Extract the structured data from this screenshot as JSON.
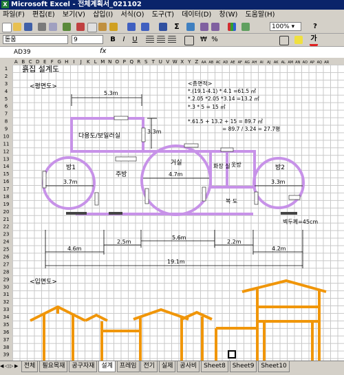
{
  "window": {
    "title": "Microsoft Excel - 전체계획서_021102"
  },
  "menu": [
    "파일(F)",
    "편집(E)",
    "보기(V)",
    "삽입(I)",
    "서식(O)",
    "도구(T)",
    "데이터(D)",
    "창(W)",
    "도움말(H)"
  ],
  "toolbar": {
    "zoom": "100%",
    "font": "돋움",
    "size": "9"
  },
  "formula": {
    "namebox": "AD39",
    "fx": "fx"
  },
  "columns": [
    "A",
    "B",
    "C",
    "D",
    "E",
    "F",
    "G",
    "H",
    "I",
    "J",
    "K",
    "L",
    "M",
    "N",
    "O",
    "P",
    "Q",
    "R",
    "S",
    "T",
    "U",
    "V",
    "W",
    "X",
    "Y",
    "Z",
    "AA",
    "AB",
    "AC",
    "AD",
    "AE",
    "AF",
    "AG",
    "AH",
    "AI",
    "AJ",
    "AK",
    "AL",
    "AM",
    "AN",
    "AO",
    "AP",
    "AQ",
    "AR"
  ],
  "rows": 39,
  "sheet": {
    "title": "흙집 설계도",
    "plan_label": "<평면도>",
    "elev_label": "<입면도>",
    "area_title": "<총면적>",
    "area_lines": [
      "*.(19.1-4.1) * 4.1 =61.5 ㎡",
      "*.2.05 *2.05 *3.14 =13.2 ㎡",
      "*.3 * 5 = 15 ㎡"
    ],
    "area_total1": "*.61.5 + 13.2 + 15 = 89.7 ㎡",
    "area_total2": "= 89.7 / 3.24 = 27.7평",
    "rooms": {
      "room1": "방1",
      "room1_w": "3.7m",
      "kitchen": "주방",
      "living": "거실",
      "living_w": "4.7m",
      "bath": "화장\n실",
      "closet": "옷방",
      "hall": "복 도",
      "room2": "방2",
      "room2_w": "3.3m",
      "utility": "다용도/보일러실"
    },
    "dims": {
      "top": "5.3m",
      "util_h": "3.3m",
      "wall": "벽두께=45cm",
      "d1": "4.6m",
      "d2": "2.5m",
      "d3": "5.6m",
      "d4": "2.2m",
      "d5": "4.2m",
      "total": "19.1m"
    }
  },
  "tabs": [
    "전체",
    "필요목재",
    "공구자재",
    "설계",
    "프레임",
    "전기",
    "실제",
    "공사비",
    "Sheet8",
    "Sheet9",
    "Sheet10"
  ],
  "active_tab": "설계",
  "colors": {
    "wall": "#c792e8",
    "frame": "#f0960a",
    "title": "#0a246a"
  }
}
